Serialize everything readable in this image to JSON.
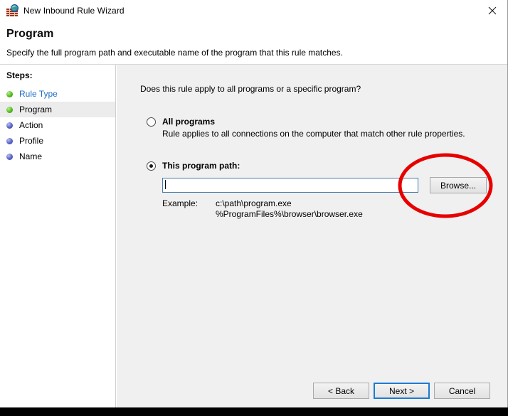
{
  "window": {
    "title": "New Inbound Rule Wizard",
    "icon": "firewall-icon",
    "close_label": "close-icon"
  },
  "header": {
    "title": "Program",
    "subtitle": "Specify the full program path and executable name of the program that this rule matches."
  },
  "sidebar": {
    "heading": "Steps:",
    "items": [
      {
        "label": "Rule Type",
        "bullet": "green",
        "state": "link"
      },
      {
        "label": "Program",
        "bullet": "green",
        "state": "current"
      },
      {
        "label": "Action",
        "bullet": "blue",
        "state": "pending"
      },
      {
        "label": "Profile",
        "bullet": "blue",
        "state": "pending"
      },
      {
        "label": "Name",
        "bullet": "blue",
        "state": "pending"
      }
    ]
  },
  "main": {
    "question": "Does this rule apply to all programs or a specific program?",
    "options": [
      {
        "label": "All programs",
        "description": "Rule applies to all connections on the computer that match other rule properties.",
        "selected": false
      },
      {
        "label": "This program path:",
        "selected": true
      }
    ],
    "path_input": {
      "value": "",
      "placeholder": ""
    },
    "browse_label": "Browse...",
    "example": {
      "label": "Example:",
      "values": [
        "c:\\path\\program.exe",
        "%ProgramFiles%\\browser\\browser.exe"
      ]
    }
  },
  "footer": {
    "back_label": "< Back",
    "next_label": "Next >",
    "cancel_label": "Cancel"
  },
  "annotation": {
    "shape": "ellipse",
    "color": "#e60000",
    "target": "Browse..."
  },
  "colors": {
    "accent_blue": "#1a7bd4",
    "link_blue": "#1f6fc4",
    "panel_gray": "#f0f0f0",
    "annotation_red": "#e60000"
  }
}
